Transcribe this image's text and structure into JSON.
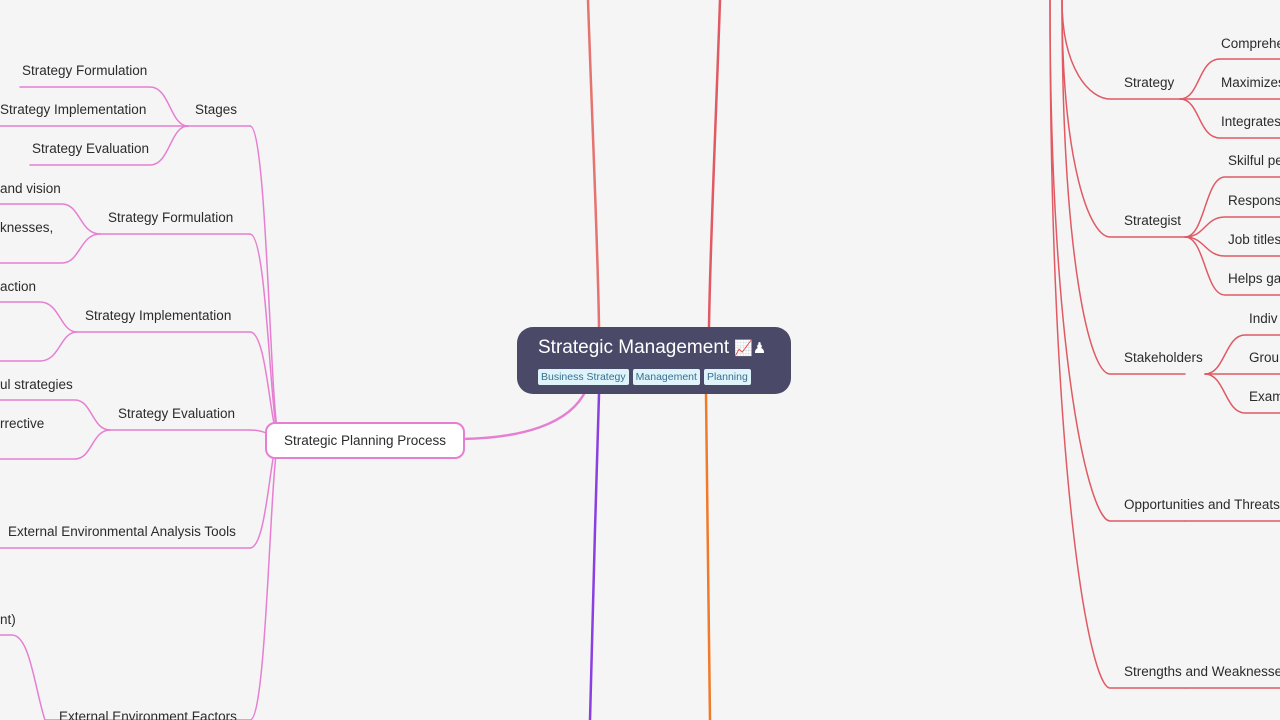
{
  "central": {
    "title": "Strategic Management",
    "emoji": "📈♟",
    "tags": [
      "Business Strategy",
      "Management",
      "Planning"
    ]
  },
  "left": {
    "main": "Strategic Planning Process",
    "subs": [
      {
        "label": "Stages",
        "children": [
          "Strategy Formulation",
          "Strategy Implementation",
          "Strategy Evaluation"
        ]
      },
      {
        "label": "Strategy Formulation",
        "children": [
          "and vision",
          "knesses,"
        ]
      },
      {
        "label": "Strategy Implementation",
        "children": [
          "action",
          ""
        ]
      },
      {
        "label": "Strategy Evaluation",
        "children": [
          "ul strategies",
          "rrective"
        ]
      },
      {
        "label": "External Environmental Analysis Tools",
        "children": []
      },
      {
        "label": "External Environment Factors",
        "children": [
          "nt)"
        ]
      }
    ]
  },
  "right": {
    "subs": [
      {
        "label": "Strategy",
        "children": [
          "Comprehe",
          "Maximizes",
          "Integrates"
        ]
      },
      {
        "label": "Strategist",
        "children": [
          "Skilful pe",
          "Responsi",
          "Job titles",
          "Helps ga"
        ]
      },
      {
        "label": "Stakeholders",
        "children": [
          "Indiv",
          "Grou",
          "Exam"
        ]
      },
      {
        "label": "Opportunities and Threats",
        "children": []
      },
      {
        "label": "Strengths and Weaknesses",
        "children": []
      }
    ]
  },
  "colors": {
    "pink": "#e67fd2",
    "red": "#e05a64",
    "purple": "#8a3fe0",
    "orange": "#f07a2a",
    "salmon": "#e57370",
    "node_bg": "#4a4a68",
    "tag_bg": "#dff3fb"
  }
}
